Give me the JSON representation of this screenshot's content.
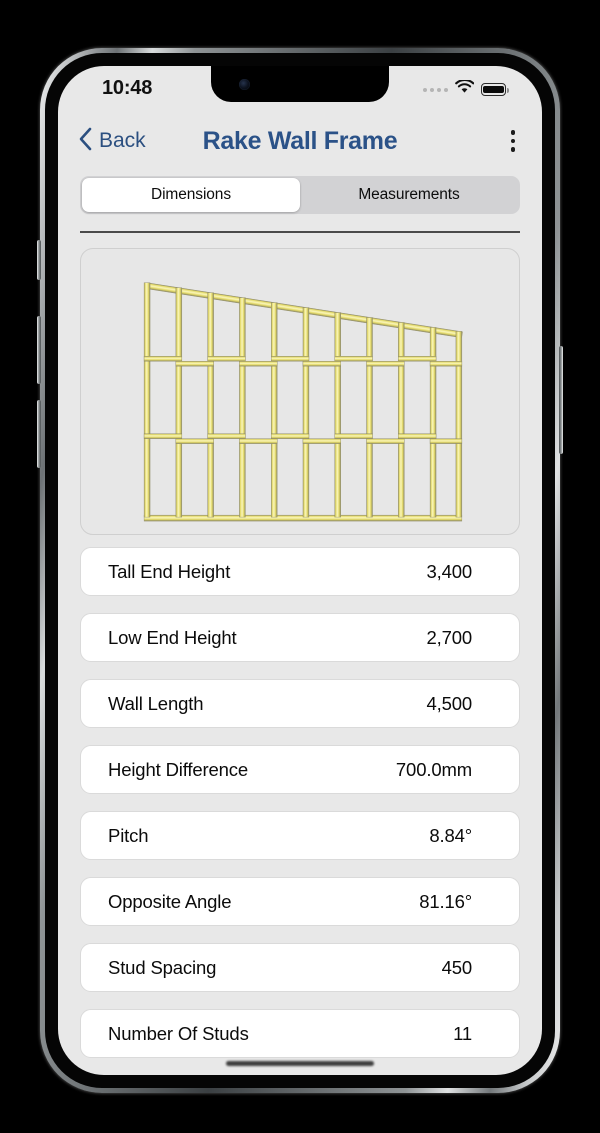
{
  "status_bar": {
    "time": "10:48",
    "signal_icon": "cellular-dots-icon",
    "wifi_icon": "wifi-icon",
    "battery_icon": "battery-full-icon"
  },
  "nav": {
    "back_label": "Back",
    "back_icon": "chevron-left-icon",
    "title": "Rake Wall Frame",
    "menu_icon": "kebab-menu-icon",
    "title_color": "#2b5288",
    "accent_color": "#2b4f80"
  },
  "tabs": [
    {
      "label": "Dimensions",
      "active": true
    },
    {
      "label": "Measurements",
      "active": false
    }
  ],
  "diagram": {
    "name": "rake-wall-frame-diagram",
    "timber_color": "#e8df6a",
    "timber_highlight": "#f7f2ae",
    "timber_edge": "#8d8a66",
    "background": "#e7e7e7",
    "stud_count": 11,
    "noggin_rows": 2
  },
  "rows": [
    {
      "label": "Tall End Height",
      "value": "3,400"
    },
    {
      "label": "Low End Height",
      "value": "2,700"
    },
    {
      "label": "Wall Length",
      "value": "4,500"
    },
    {
      "label": "Height Difference",
      "value": "700.0mm"
    },
    {
      "label": "Pitch",
      "value": "8.84°"
    },
    {
      "label": "Opposite Angle",
      "value": "81.16°"
    },
    {
      "label": "Stud Spacing",
      "value": "450"
    },
    {
      "label": "Number Of Studs",
      "value": "11"
    }
  ]
}
